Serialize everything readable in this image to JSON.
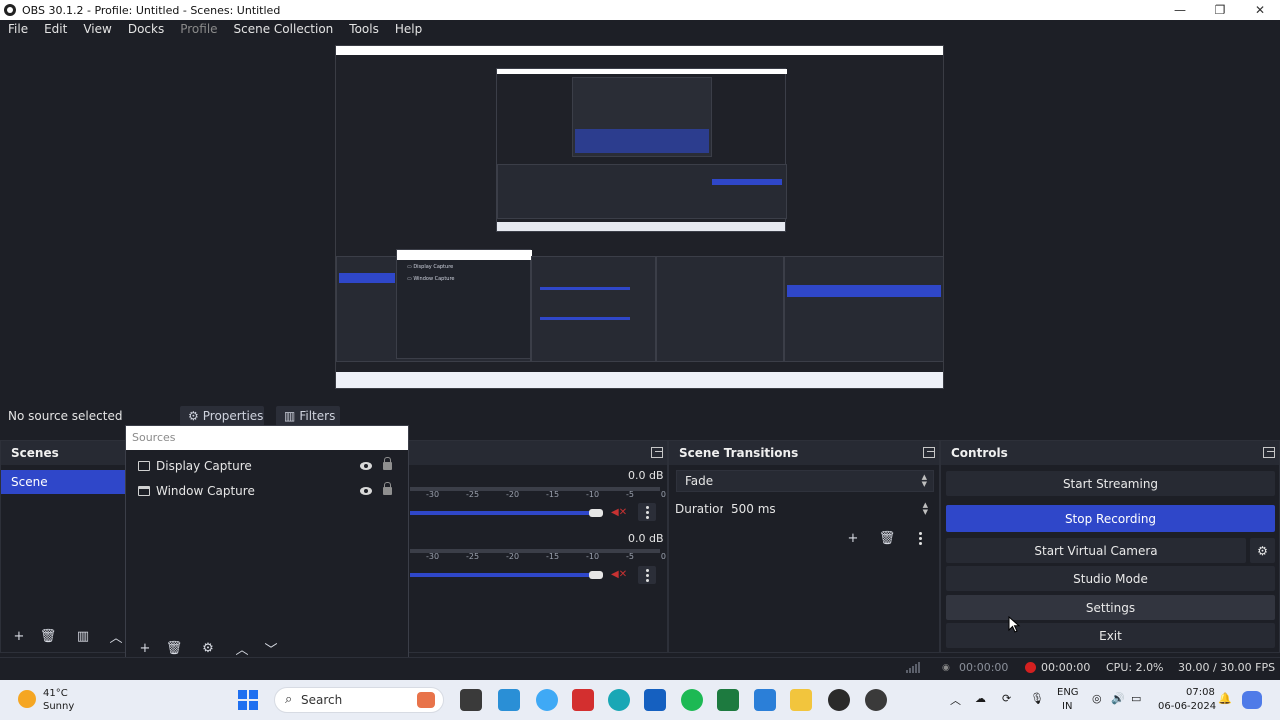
{
  "window": {
    "title": "OBS 30.1.2 - Profile: Untitled - Scenes: Untitled",
    "minimize": "—",
    "maximize": "❐",
    "close": "✕"
  },
  "menu": {
    "items": [
      "File",
      "Edit",
      "View",
      "Docks",
      "Profile",
      "Scene Collection",
      "Tools",
      "Help"
    ]
  },
  "source_toolbar": {
    "no_source": "No source selected",
    "properties": "Properties",
    "filters": "Filters"
  },
  "scenes": {
    "title": "Scenes",
    "items": [
      "Scene"
    ]
  },
  "sources": {
    "header": "Sources",
    "items": [
      "Display Capture",
      "Window Capture"
    ]
  },
  "mixer": {
    "channels": [
      {
        "db": "0.0 dB",
        "ticks": [
          "-30",
          "-25",
          "-20",
          "-15",
          "-10",
          "-5",
          "0"
        ]
      },
      {
        "db": "0.0 dB",
        "ticks": [
          "-30",
          "-25",
          "-20",
          "-15",
          "-10",
          "-5",
          "0"
        ]
      }
    ]
  },
  "transitions": {
    "title": "Scene Transitions",
    "selected": "Fade",
    "duration_label": "Duration",
    "duration_value": "500 ms"
  },
  "controls": {
    "title": "Controls",
    "start_streaming": "Start Streaming",
    "stop_recording": "Stop Recording",
    "start_virtual_camera": "Start Virtual Camera",
    "studio_mode": "Studio Mode",
    "settings": "Settings",
    "exit": "Exit"
  },
  "status": {
    "stream_time": "00:00:00",
    "rec_time": "00:00:00",
    "cpu": "CPU: 2.0%",
    "fps": "30.00 / 30.00 FPS"
  },
  "taskbar": {
    "weather_temp": "41°C",
    "weather_desc": "Sunny",
    "search": "Search",
    "lang_top": "ENG",
    "lang_bottom": "IN",
    "time": "07:08",
    "date": "06-06-2024"
  },
  "colors": {
    "accent": "#2f47c9",
    "panel": "#272a33",
    "background": "#1d1f26",
    "record": "#d42020"
  }
}
